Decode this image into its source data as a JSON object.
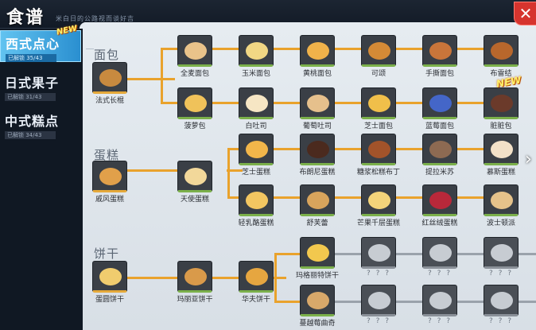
{
  "header": {
    "title": "食谱",
    "subtitle": "米白日的公路视而谈好吉"
  },
  "sidebar": {
    "tabs": [
      {
        "label": "西式点心",
        "progress": "已解锁 35/43",
        "active": true,
        "badge": "NEW"
      },
      {
        "label": "日式果子",
        "progress": "已解锁 31/43",
        "active": false
      },
      {
        "label": "中式糕点",
        "progress": "已解锁 34/43",
        "active": false
      }
    ]
  },
  "categories": [
    {
      "label": "面包"
    },
    {
      "label": "蛋糕"
    },
    {
      "label": "饼干"
    }
  ],
  "recipes": {
    "bread": {
      "base": {
        "name": "法式长棍"
      },
      "row1": [
        {
          "name": "全麦面包"
        },
        {
          "name": "玉米面包"
        },
        {
          "name": "黄桃面包"
        },
        {
          "name": "可颂"
        },
        {
          "name": "手撕面包"
        },
        {
          "name": "布雷结"
        }
      ],
      "row2": [
        {
          "name": "菠萝包"
        },
        {
          "name": "白吐司"
        },
        {
          "name": "葡萄吐司"
        },
        {
          "name": "芝士面包"
        },
        {
          "name": "蓝莓面包"
        },
        {
          "name": "脏脏包"
        }
      ]
    },
    "cake": {
      "base": {
        "name": "戚风蛋糕"
      },
      "mid": {
        "name": "天使蛋糕"
      },
      "row1": [
        {
          "name": "芝士蛋糕"
        },
        {
          "name": "布朗尼蛋糕"
        },
        {
          "name": "糖浆松糕布丁"
        },
        {
          "name": "提拉米苏"
        },
        {
          "name": "慕斯蛋糕"
        }
      ],
      "row2": [
        {
          "name": "轻乳酪蛋糕"
        },
        {
          "name": "舒芙蕾"
        },
        {
          "name": "芒果千层蛋糕"
        },
        {
          "name": "红丝绒蛋糕"
        },
        {
          "name": "波士顿派"
        }
      ]
    },
    "cookie": {
      "base": {
        "name": "蛋圆饼干"
      },
      "mid": {
        "name": "玛丽亚饼干"
      },
      "mid2": {
        "name": "华夫饼干"
      },
      "row1": [
        {
          "name": "玛格丽特饼干"
        },
        {
          "name": "? ? ?"
        },
        {
          "name": "? ? ?"
        },
        {
          "name": "? ? ?"
        }
      ],
      "row2": [
        {
          "name": "蔓越莓曲奇"
        },
        {
          "name": "? ? ?"
        },
        {
          "name": "? ? ?"
        },
        {
          "name": "? ? ?"
        }
      ]
    }
  },
  "badges": {
    "corner_new": "NEW"
  },
  "icons": {
    "close": "close-icon",
    "scroll": "chevron-right-icon"
  },
  "colors": {
    "accent": "#3aa6e4",
    "connector": "#e9a22c",
    "locked_connector": "#9aa2ab",
    "close": "#d6342e"
  }
}
